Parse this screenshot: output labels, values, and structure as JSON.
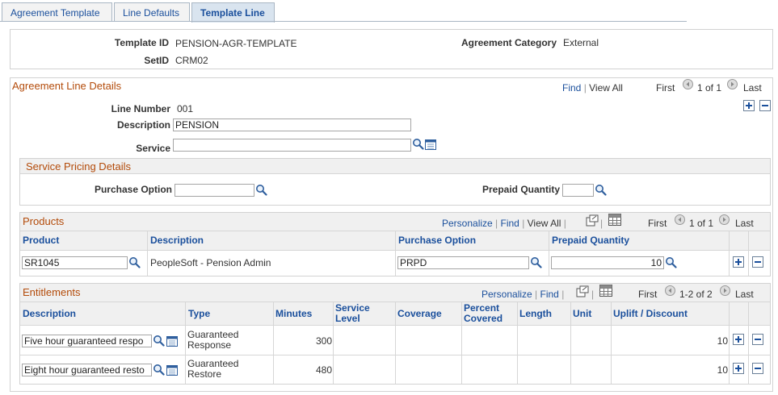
{
  "tabs": [
    {
      "label": "Agreement Template"
    },
    {
      "label": "Line Defaults"
    },
    {
      "label": "Template Line"
    }
  ],
  "header": {
    "template_id_label": "Template ID",
    "template_id_value": "PENSION-AGR-TEMPLATE",
    "agreement_category_label": "Agreement Category",
    "agreement_category_value": "External",
    "setid_label": "SetID",
    "setid_value": "CRM02"
  },
  "line_details": {
    "title": "Agreement Line Details",
    "find": "Find",
    "view_all": "View All",
    "first": "First",
    "range": "1 of 1",
    "last": "Last",
    "line_number_label": "Line Number",
    "line_number_value": "001",
    "description_label": "Description",
    "description_value": "PENSION",
    "service_label": "Service",
    "service_value": ""
  },
  "pricing": {
    "title": "Service Pricing Details",
    "purchase_option_label": "Purchase Option",
    "purchase_option_value": "",
    "prepaid_quantity_label": "Prepaid Quantity",
    "prepaid_quantity_value": ""
  },
  "products": {
    "title": "Products",
    "personalize": "Personalize",
    "find": "Find",
    "view_all": "View All",
    "first": "First",
    "range": "1 of 1",
    "last": "Last",
    "columns": [
      "Product",
      "Description",
      "Purchase Option",
      "Prepaid Quantity"
    ],
    "rows": [
      {
        "product": "SR1045",
        "description": "PeopleSoft - Pension Admin",
        "purchase_option": "PRPD",
        "prepaid_quantity": "10"
      }
    ]
  },
  "entitlements": {
    "title": "Entitlements",
    "personalize": "Personalize",
    "find": "Find",
    "first": "First",
    "range": "1-2 of 2",
    "last": "Last",
    "columns": [
      "Description",
      "Type",
      "Minutes",
      "Service Level",
      "Coverage",
      "Percent Covered",
      "Length",
      "Unit",
      "Uplift / Discount"
    ],
    "rows": [
      {
        "description": "Five hour guaranteed respo",
        "type": "Guaranteed Response",
        "minutes": "300",
        "uplift": "10"
      },
      {
        "description": "Eight hour guaranteed resto",
        "type": "Guaranteed Restore",
        "minutes": "480",
        "uplift": "10"
      }
    ]
  }
}
